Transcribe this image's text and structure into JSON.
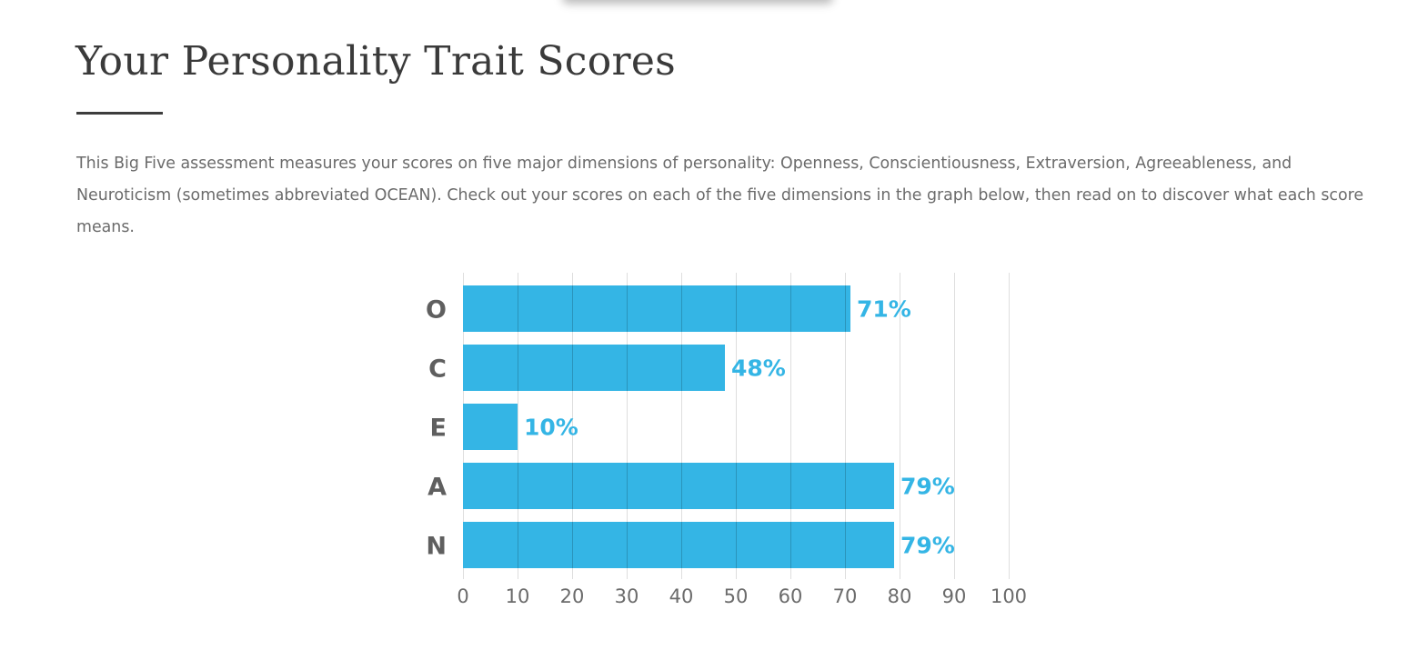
{
  "page": {
    "title": "Your Personality Trait Scores",
    "intro": "This Big Five assessment measures your scores on five major dimensions of personality: Openness, Conscientiousness, Extraversion, Agreeableness, and Neuroticism (sometimes abbreviated OCEAN). Check out your scores on each of the five dimensions in the graph below, then read on to discover what each score means."
  },
  "chart_data": {
    "type": "bar",
    "orientation": "horizontal",
    "categories": [
      "O",
      "C",
      "E",
      "A",
      "N"
    ],
    "values": [
      71,
      48,
      10,
      79,
      79
    ],
    "value_labels": [
      "71%",
      "48%",
      "10%",
      "79%",
      "79%"
    ],
    "xlim": [
      0,
      100
    ],
    "xticks": [
      0,
      10,
      20,
      30,
      40,
      50,
      60,
      70,
      80,
      90,
      100
    ],
    "grid": true,
    "bar_color": "#34b5e5",
    "title": "",
    "xlabel": "",
    "ylabel": ""
  }
}
